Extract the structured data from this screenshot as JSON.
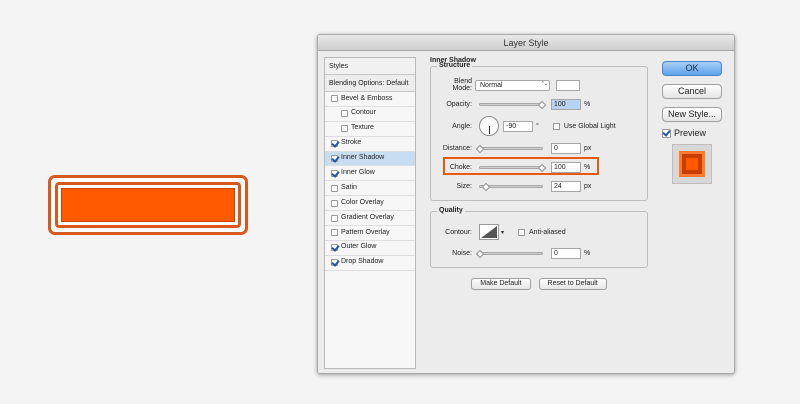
{
  "dialog": {
    "title": "Layer Style"
  },
  "styles_list": {
    "header": "Styles",
    "blending_options": "Blending Options: Default",
    "items": [
      {
        "label": "Bevel & Emboss",
        "checked": false,
        "indent": false,
        "selected": false
      },
      {
        "label": "Contour",
        "checked": false,
        "indent": true,
        "selected": false
      },
      {
        "label": "Texture",
        "checked": false,
        "indent": true,
        "selected": false
      },
      {
        "label": "Stroke",
        "checked": true,
        "indent": false,
        "selected": false
      },
      {
        "label": "Inner Shadow",
        "checked": true,
        "indent": false,
        "selected": true
      },
      {
        "label": "Inner Glow",
        "checked": true,
        "indent": false,
        "selected": false
      },
      {
        "label": "Satin",
        "checked": false,
        "indent": false,
        "selected": false
      },
      {
        "label": "Color Overlay",
        "checked": false,
        "indent": false,
        "selected": false
      },
      {
        "label": "Gradient Overlay",
        "checked": false,
        "indent": false,
        "selected": false
      },
      {
        "label": "Pattern Overlay",
        "checked": false,
        "indent": false,
        "selected": false
      },
      {
        "label": "Outer Glow",
        "checked": true,
        "indent": false,
        "selected": false
      },
      {
        "label": "Drop Shadow",
        "checked": true,
        "indent": false,
        "selected": false
      }
    ]
  },
  "inner_shadow": {
    "section_title": "Inner Shadow",
    "structure": {
      "label": "Structure",
      "blend_mode_label": "Blend Mode:",
      "blend_mode_value": "Normal",
      "opacity_label": "Opacity:",
      "opacity_value": "100",
      "opacity_slider": 1.0,
      "angle_label": "Angle:",
      "angle_value": "-90",
      "angle_unit": "°",
      "use_global_light": "Use Global Light",
      "distance_label": "Distance:",
      "distance_value": "0",
      "distance_slider": 0.0,
      "choke_label": "Choke:",
      "choke_value": "100",
      "choke_slider": 1.0,
      "size_label": "Size:",
      "size_value": "24",
      "size_slider": 0.1,
      "unit_px": "px",
      "unit_pct": "%"
    },
    "quality": {
      "label": "Quality",
      "contour_label": "Contour:",
      "anti_aliased": "Anti-aliased",
      "noise_label": "Noise:",
      "noise_value": "0",
      "noise_slider": 0.0
    },
    "make_default": "Make Default",
    "reset_default": "Reset to Default"
  },
  "buttons": {
    "ok": "OK",
    "cancel": "Cancel",
    "new_style": "New Style...",
    "preview": "Preview",
    "preview_checked": true
  },
  "colors": {
    "accent_orange": "#ff5a00",
    "stroke_orange": "#d8581d",
    "highlight": "#e85a10"
  }
}
